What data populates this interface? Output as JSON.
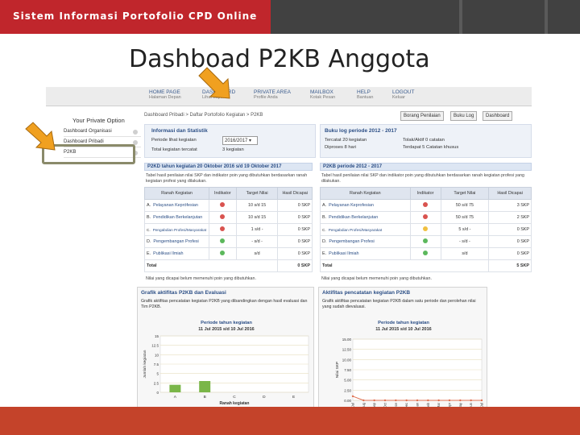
{
  "slide": {
    "header": "Sistem Informasi Portofolio CPD Online",
    "title": "Dashboad P2KB Anggota"
  },
  "colors": {
    "banner_red": "#c0262c",
    "banner_grey": "#414141",
    "bottom_bar": "#c4432a",
    "arrow_orange": "#f0a020",
    "link_blue": "#2c4f86",
    "indicator_red": "#d9534f",
    "indicator_green": "#5cb85c",
    "indicator_yellow": "#f0c040",
    "bar_green": "#7ab648"
  },
  "nav": [
    {
      "label": "HOME PAGE",
      "sub": "Halaman Depan"
    },
    {
      "label": "DASHBOARD",
      "sub": "Lihat Laporan"
    },
    {
      "label": "PRIVATE AREA",
      "sub": "Profile Anda"
    },
    {
      "label": "MAILBOX",
      "sub": "Kotak Pesan"
    },
    {
      "label": "HELP",
      "sub": "Bantuan"
    },
    {
      "label": "LOGOUT",
      "sub": "Keluar"
    }
  ],
  "sidebar": {
    "title": "Your Private Option",
    "items": [
      {
        "label": "Dashboard Organisasi",
        "icon": "chevron-circle-icon"
      },
      {
        "label": "Dashboard Pribadi",
        "icon": "chevron-circle-icon"
      },
      {
        "label": "P2KB",
        "icon": "chevron-circle-icon"
      }
    ]
  },
  "content": {
    "breadcrumb": "Dashboard Pribadi > Daftar Portofolio Kegiatan > P2KB",
    "buttons": [
      "Borang Penilaian",
      "Buku Log",
      "Dashboard"
    ]
  },
  "info": {
    "title": "Informasi dan Statistik",
    "period_label": "Periode lihat kegiatan",
    "period_value": "2016/2017",
    "total_label": "Total kegiatan tercatat",
    "total_value": "3 kegiatan"
  },
  "log": {
    "title": "Buku log periode 2012 - 2017",
    "items": [
      "Tercatat 20 kegiatan",
      "Tolak/Aktif 0 catatan",
      "Diproses 8 hari",
      "Terdapat 5 Catatan khusus"
    ]
  },
  "p2kd": {
    "title": "P2KD tahun kegiatan 20 Oktober 2016 s/d 19 Oktober 2017",
    "desc": "Tabel hasil penilaian nilai SKP dan indikator poin yang dibutuhkan berdasarkan ranah kegiatan profesi yang dilakukan.",
    "headers": [
      "Ranah Kegiatan",
      "Indikator",
      "Target Nilai",
      "Hasil Dicapai"
    ],
    "rows": [
      {
        "code": "A.",
        "name": "Pelayanan Keprófesian",
        "status": "red",
        "target": "10 s/d 15",
        "result": "0 SKP"
      },
      {
        "code": "B.",
        "name": "Pendidikan Berkelanjutan",
        "status": "red",
        "target": "10 s/d 15",
        "result": "0 SKP"
      },
      {
        "code": "C.",
        "name": "Pengabdian Profesi/Masyarakat",
        "status": "red",
        "target": "1 s/d -",
        "result": "0 SKP"
      },
      {
        "code": "D.",
        "name": "Pengembangan Profesi",
        "status": "green",
        "target": "- s/d -",
        "result": "0 SKP"
      },
      {
        "code": "E.",
        "name": "Publikasi Ilmiah",
        "status": "green",
        "target": "s/d",
        "result": "0 SKP"
      }
    ],
    "total_label": "Total",
    "total_value": "0 SKP",
    "footnote": "Nilai yang dicapai belum memenuhi poin yang dibutuhkan."
  },
  "p2kb": {
    "title": "P2KB periode 2012 - 2017",
    "desc": "Tabel hasil penilaian nilai SKP dan indikator poin yang dibutuhkan berdasarkan ranah kegiatan profesi yang dilakukan.",
    "headers": [
      "Ranah Kegiatan",
      "Indikator",
      "Target Nilai",
      "Hasil Dicapai"
    ],
    "rows": [
      {
        "code": "A.",
        "name": "Pelayanan Keprofesian",
        "status": "red",
        "target": "50 s/d 75",
        "result": "3 SKP"
      },
      {
        "code": "B.",
        "name": "Pendidikan Berkelanjutan",
        "status": "red",
        "target": "50 s/d 75",
        "result": "2 SKP"
      },
      {
        "code": "C.",
        "name": "Pengabdian Profesi/Masyarakat",
        "status": "yellow",
        "target": "5 s/d -",
        "result": "0 SKP"
      },
      {
        "code": "D.",
        "name": "Pengembangan Profesi",
        "status": "green",
        "target": "- s/d -",
        "result": "0 SKP"
      },
      {
        "code": "E.",
        "name": "Publikasi Ilmiah",
        "status": "green",
        "target": "s/d",
        "result": "0 SKP"
      }
    ],
    "total_label": "Total",
    "total_value": "5 SKP",
    "footnote": "Nilai yang dicapai belum memenuhi poin yang dibutuhkan."
  },
  "chart_data": [
    {
      "type": "bar",
      "panel_title": "Grafik aktifitas P2KB dan Evaluasi",
      "panel_desc": "Grafik aktifitas pencatatan kegiatan P2KB yang dibandingkan dengan hasil evaluasi dan Tim P2KB.",
      "title": "Periode tahun kegiatan",
      "subtitle": "11 Jul 2015 s/d 10 Jul 2016",
      "xlabel": "Ranah kegiatan",
      "ylabel": "Jumlah kegiatan",
      "categories": [
        "A",
        "B",
        "C",
        "D",
        "E"
      ],
      "series": [
        {
          "name": "Accepted",
          "color": "#7ab648",
          "values": [
            2,
            3,
            0,
            0,
            0
          ]
        },
        {
          "name": "Rejected",
          "color": "#d9534f",
          "values": [
            0,
            0,
            0,
            0,
            0
          ]
        },
        {
          "name": "Waiting",
          "color": "#f0c040",
          "values": [
            0,
            0,
            0,
            0,
            0
          ]
        }
      ],
      "ylim": [
        0,
        15
      ],
      "yticks": [
        0,
        2.5,
        5,
        7.5,
        10,
        12.5,
        15
      ],
      "grid": true,
      "legend": "bottom"
    },
    {
      "type": "line",
      "panel_title": "Aktifitas pencatatan kegiatan P2KB",
      "panel_desc": "Grafik aktifitas pencatatan kegiatan P2KB dalam satu periode dan perolehan nilai yang sudah dievaluasi.",
      "title": "Periode tahun kegiatan",
      "subtitle": "11 Jul 2015 s/d 10 Jul 2016",
      "xlabel": "Bulan",
      "ylabel": "Nilai SKP",
      "categories": [
        "Jul",
        "Aug",
        "Sep",
        "Oct",
        "Nov",
        "Dec",
        "Jan",
        "Feb",
        "Mar",
        "Apr",
        "May",
        "Jun",
        "Jul"
      ],
      "series": [
        {
          "name": "",
          "color": "#e07050",
          "values": [
            1,
            0,
            0,
            0,
            0,
            0,
            0,
            0,
            0,
            0,
            0,
            0,
            0
          ]
        }
      ],
      "ylim": [
        0,
        15
      ],
      "yticks": [
        "0.00",
        "2.50",
        "5.00",
        "7.50",
        "10.00",
        "12.50",
        "15.00"
      ],
      "grid": true
    }
  ]
}
